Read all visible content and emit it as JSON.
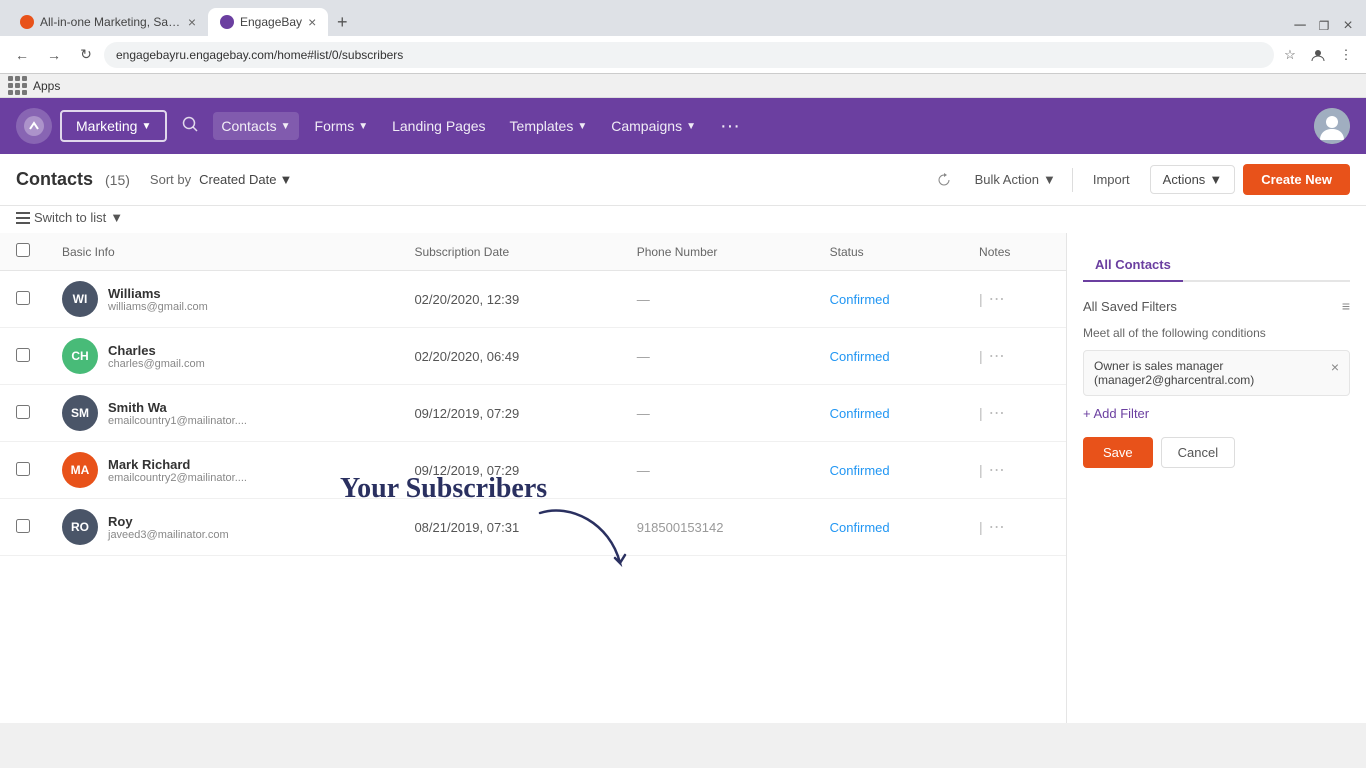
{
  "browser": {
    "tabs": [
      {
        "id": "tab1",
        "title": "All-in-one Marketing, Sales, Supp...",
        "favicon_color": "#e8521a",
        "active": false
      },
      {
        "id": "tab2",
        "title": "EngageBay",
        "favicon_color": "#6b3fa0",
        "active": true
      }
    ],
    "address": "engagebayru.engagebay.com/home#list/0/subscribers"
  },
  "app_bar": {
    "apps_label": "Apps"
  },
  "nav": {
    "marketing_label": "Marketing",
    "contacts_label": "Contacts",
    "forms_label": "Forms",
    "landing_pages_label": "Landing Pages",
    "templates_label": "Templates",
    "campaigns_label": "Campaigns",
    "more_label": "···"
  },
  "toolbar": {
    "page_title": "Contacts",
    "count": "(15)",
    "sort_by_label": "Sort by",
    "sort_value": "Created Date",
    "bulk_action_label": "Bulk Action",
    "import_label": "Import",
    "actions_label": "Actions",
    "create_new_label": "Create New"
  },
  "sub_toolbar": {
    "switch_to_list_label": "Switch to list"
  },
  "annotation": {
    "text": "Your Subscribers"
  },
  "table": {
    "headers": [
      "Basic Info",
      "Subscription Date",
      "Phone Number",
      "Status",
      "Notes"
    ],
    "rows": [
      {
        "id": 1,
        "initials": "WI",
        "avatar_color": "#4a5568",
        "name": "Williams",
        "email": "williams@gmail.com",
        "subscription_date": "02/20/2020, 12:39",
        "phone": "—",
        "status": "Confirmed"
      },
      {
        "id": 2,
        "initials": "CH",
        "avatar_color": "#48bb78",
        "name": "Charles",
        "email": "charles@gmail.com",
        "subscription_date": "02/20/2020, 06:49",
        "phone": "—",
        "status": "Confirmed"
      },
      {
        "id": 3,
        "initials": "SM",
        "avatar_color": "#4a5568",
        "name": "Smith Wa",
        "email": "emailcountry1@mailinator....",
        "subscription_date": "09/12/2019, 07:29",
        "phone": "—",
        "status": "Confirmed"
      },
      {
        "id": 4,
        "initials": "MA",
        "avatar_color": "#e8521a",
        "name": "Mark Richard",
        "email": "emailcountry2@mailinator....",
        "subscription_date": "09/12/2019, 07:29",
        "phone": "—",
        "status": "Confirmed"
      },
      {
        "id": 5,
        "initials": "RO",
        "avatar_color": "#4a5568",
        "name": "Roy",
        "email": "javeed3@mailinator.com",
        "subscription_date": "08/21/2019, 07:31",
        "phone": "918500153142",
        "status": "Confirmed"
      }
    ]
  },
  "right_panel": {
    "all_contacts_label": "All Contacts",
    "all_saved_filters_label": "All Saved Filters",
    "condition_text": "Meet all of the following conditions",
    "filter_text": "Owner is sales manager (manager2@gharcentral.com)",
    "add_filter_label": "+ Add Filter",
    "save_label": "Save",
    "cancel_label": "Cancel"
  }
}
